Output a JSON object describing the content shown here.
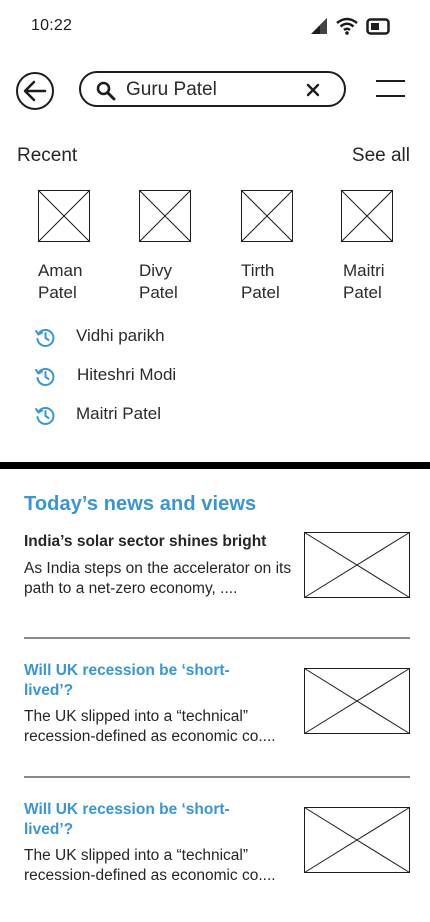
{
  "status_bar": {
    "time": "10:22"
  },
  "search": {
    "value": "Guru Patel"
  },
  "recent": {
    "title": "Recent",
    "see_all_label": "See all",
    "people": [
      {
        "name": "Aman\nPatel"
      },
      {
        "name": "Divy\nPatel"
      },
      {
        "name": "Tirth\nPatel"
      },
      {
        "name": "Maitri\nPatel"
      }
    ],
    "history": [
      {
        "label": "Vidhi parikh"
      },
      {
        "label": "Hiteshri Modi"
      },
      {
        "label": "Maitri Patel"
      }
    ]
  },
  "news": {
    "heading": "Today’s news and views",
    "items": [
      {
        "title": "India’s solar sector shines bright",
        "body": "As India steps on the accelerator on its path to a net-zero economy, ....",
        "title_color": "#262626"
      },
      {
        "title": "Will UK recession be ‘short-lived’?",
        "body": "The UK slipped into a “technical” recession-defined as economic co....",
        "title_color": "#3796d8"
      },
      {
        "title": "Will UK recession be ‘short-lived’?",
        "body": "The UK slipped into a “technical” recession-defined as economic co....",
        "title_color": "#3796d8"
      }
    ]
  },
  "colors": {
    "accent": "#3796d8",
    "divider": "#000000"
  }
}
